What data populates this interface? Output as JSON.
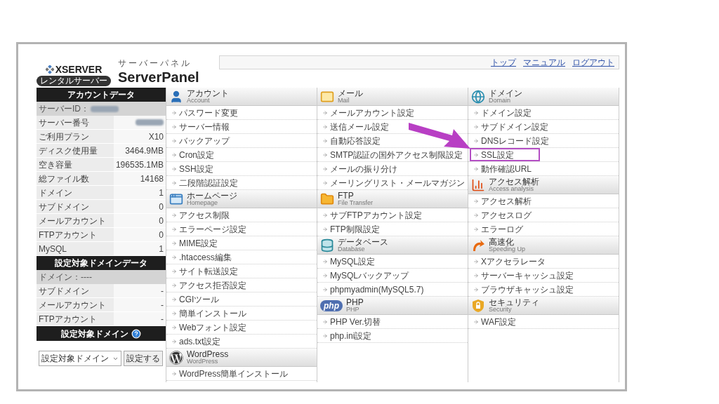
{
  "logo": {
    "brand": "XSERVER",
    "badge": "レンタルサーバー",
    "kana": "サーバーパネル",
    "product": "ServerPanel"
  },
  "header_links": [
    "トップ",
    "マニュアル",
    "ログアウト"
  ],
  "sidebar": {
    "account_title": "アカウントデータ",
    "server_id": {
      "label": "サーバーID：",
      "blurred": true
    },
    "account_rows": [
      {
        "label": "サーバー番号",
        "blurred": true
      },
      {
        "label": "ご利用プラン",
        "value": "X10",
        "blurred": false
      },
      {
        "label": "ディスク使用量",
        "value": "3464.9MB",
        "blurred": false
      },
      {
        "label": "空き容量",
        "value": "196535.1MB",
        "blurred": false
      },
      {
        "label": "総ファイル数",
        "value": "14168",
        "blurred": false
      },
      {
        "label": "ドメイン",
        "value": "1",
        "blurred": false
      },
      {
        "label": "サブドメイン",
        "value": "0",
        "blurred": false
      },
      {
        "label": "メールアカウント",
        "value": "0",
        "blurred": false
      },
      {
        "label": "FTPアカウント",
        "value": "0",
        "blurred": false
      },
      {
        "label": "MySQL",
        "value": "1",
        "blurred": false
      }
    ],
    "domain_title": "設定対象ドメインデータ",
    "domain_label": "ドメイン：----",
    "domain_rows": [
      {
        "label": "サブドメイン",
        "value": "-"
      },
      {
        "label": "メールアカウント",
        "value": "-"
      },
      {
        "label": "FTPアカウント",
        "value": "-"
      }
    ],
    "select_title": "設定対象ドメイン",
    "select": {
      "value": "設定対象ドメイン"
    },
    "select_button": "設定する"
  },
  "menu_columns": [
    {
      "sections": [
        {
          "kind": "account",
          "title": "アカウント",
          "subtitle": "Account",
          "items": [
            {
              "label": "パスワード変更",
              "highlighted": false
            },
            {
              "label": "サーバー情報",
              "highlighted": false
            },
            {
              "label": "バックアップ",
              "highlighted": false
            },
            {
              "label": "Cron設定",
              "highlighted": false
            },
            {
              "label": "SSH設定",
              "highlighted": false
            },
            {
              "label": "二段階認証設定",
              "highlighted": false
            }
          ]
        },
        {
          "kind": "homepage",
          "title": "ホームページ",
          "subtitle": "Homepage",
          "items": [
            {
              "label": "アクセス制限",
              "highlighted": false
            },
            {
              "label": "エラーページ設定",
              "highlighted": false
            },
            {
              "label": "MIME設定",
              "highlighted": false
            },
            {
              "label": ".htaccess編集",
              "highlighted": false
            },
            {
              "label": "サイト転送設定",
              "highlighted": false
            },
            {
              "label": "アクセス拒否設定",
              "highlighted": false
            },
            {
              "label": "CGIツール",
              "highlighted": false
            },
            {
              "label": "簡単インストール",
              "highlighted": false
            },
            {
              "label": "Webフォント設定",
              "highlighted": false
            },
            {
              "label": "ads.txt設定",
              "highlighted": false
            }
          ]
        },
        {
          "kind": "wordpress",
          "title": "WordPress",
          "subtitle": "WordPress",
          "items": [
            {
              "label": "WordPress簡単インストール",
              "highlighted": false
            }
          ]
        }
      ]
    },
    {
      "sections": [
        {
          "kind": "mail",
          "title": "メール",
          "subtitle": "Mail",
          "items": [
            {
              "label": "メールアカウント設定",
              "highlighted": false
            },
            {
              "label": "送信メール設定",
              "highlighted": false
            },
            {
              "label": "自動応答設定",
              "highlighted": false
            },
            {
              "label": "SMTP認証の国外アクセス制限設定",
              "highlighted": false
            },
            {
              "label": "メールの振り分け",
              "highlighted": false
            },
            {
              "label": "メーリングリスト・メールマガジン",
              "highlighted": false
            }
          ]
        },
        {
          "kind": "ftp",
          "title": "FTP",
          "subtitle": "File Transfer",
          "items": [
            {
              "label": "サブFTPアカウント設定",
              "highlighted": false
            },
            {
              "label": "FTP制限設定",
              "highlighted": false
            }
          ]
        },
        {
          "kind": "database",
          "title": "データベース",
          "subtitle": "Database",
          "items": [
            {
              "label": "MySQL設定",
              "highlighted": false
            },
            {
              "label": "MySQLバックアップ",
              "highlighted": false
            },
            {
              "label": "phpmyadmin(MySQL5.7)",
              "highlighted": false
            }
          ]
        },
        {
          "kind": "php",
          "icon_text": "php",
          "title": "PHP",
          "subtitle": "PHP",
          "items": [
            {
              "label": "PHP Ver.切替",
              "highlighted": false
            },
            {
              "label": "php.ini設定",
              "highlighted": false
            }
          ]
        }
      ]
    },
    {
      "sections": [
        {
          "kind": "domain",
          "title": "ドメイン",
          "subtitle": "Domain",
          "items": [
            {
              "label": "ドメイン設定",
              "highlighted": false
            },
            {
              "label": "サブドメイン設定",
              "highlighted": false
            },
            {
              "label": "DNSレコード設定",
              "highlighted": false
            },
            {
              "label": "SSL設定",
              "highlighted": true
            },
            {
              "label": "動作確認URL",
              "highlighted": false
            }
          ]
        },
        {
          "kind": "access",
          "title": "アクセス解析",
          "subtitle": "Access analysis",
          "items": [
            {
              "label": "アクセス解析",
              "highlighted": false
            },
            {
              "label": "アクセスログ",
              "highlighted": false
            },
            {
              "label": "エラーログ",
              "highlighted": false
            }
          ]
        },
        {
          "kind": "speed",
          "title": "高速化",
          "subtitle": "Speeding Up",
          "items": [
            {
              "label": "Xアクセラレータ",
              "highlighted": false
            },
            {
              "label": "サーバーキャッシュ設定",
              "highlighted": false
            },
            {
              "label": "ブラウザキャッシュ設定",
              "highlighted": false
            }
          ]
        },
        {
          "kind": "security",
          "title": "セキュリティ",
          "subtitle": "Security",
          "items": [
            {
              "label": "WAF設定",
              "highlighted": false
            }
          ]
        }
      ]
    }
  ]
}
